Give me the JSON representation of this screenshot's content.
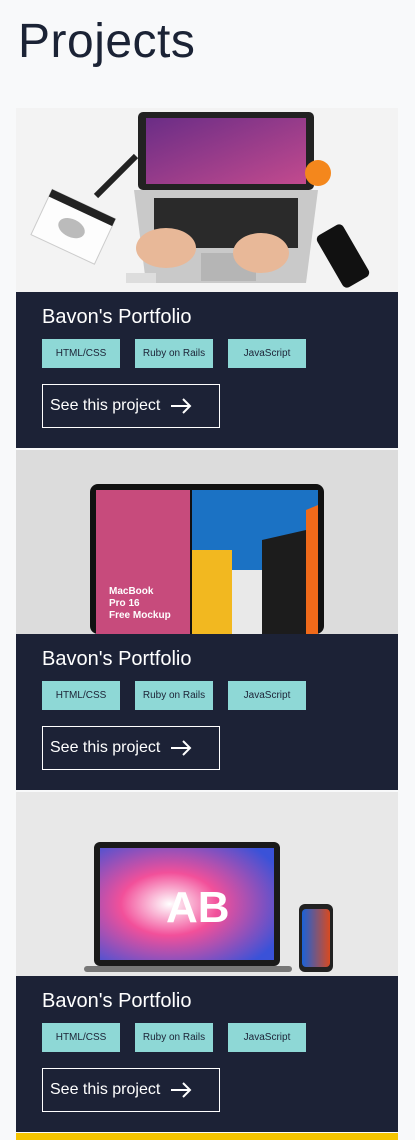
{
  "page": {
    "title": "Projects"
  },
  "projects": [
    {
      "title": "Bavon's Portfolio",
      "tags": [
        "HTML/CSS",
        "Ruby on Rails",
        "JavaScript"
      ],
      "cta": "See this project",
      "image_icon": "laptop-desk-photo"
    },
    {
      "title": "Bavon's Portfolio",
      "tags": [
        "HTML/CSS",
        "Ruby on Rails",
        "JavaScript"
      ],
      "cta": "See this project",
      "image_icon": "macbook-mockup",
      "image_text": [
        "MacBook",
        "Pro 16",
        "Free Mockup"
      ]
    },
    {
      "title": "Bavon's Portfolio",
      "tags": [
        "HTML/CSS",
        "Ruby on Rails",
        "JavaScript"
      ],
      "cta": "See this project",
      "image_icon": "laptop-phone-mockup"
    }
  ],
  "colors": {
    "card": "#1c2236",
    "tag": "#8ed8d6",
    "title": "#1b2335",
    "accent": "#f5c400"
  }
}
